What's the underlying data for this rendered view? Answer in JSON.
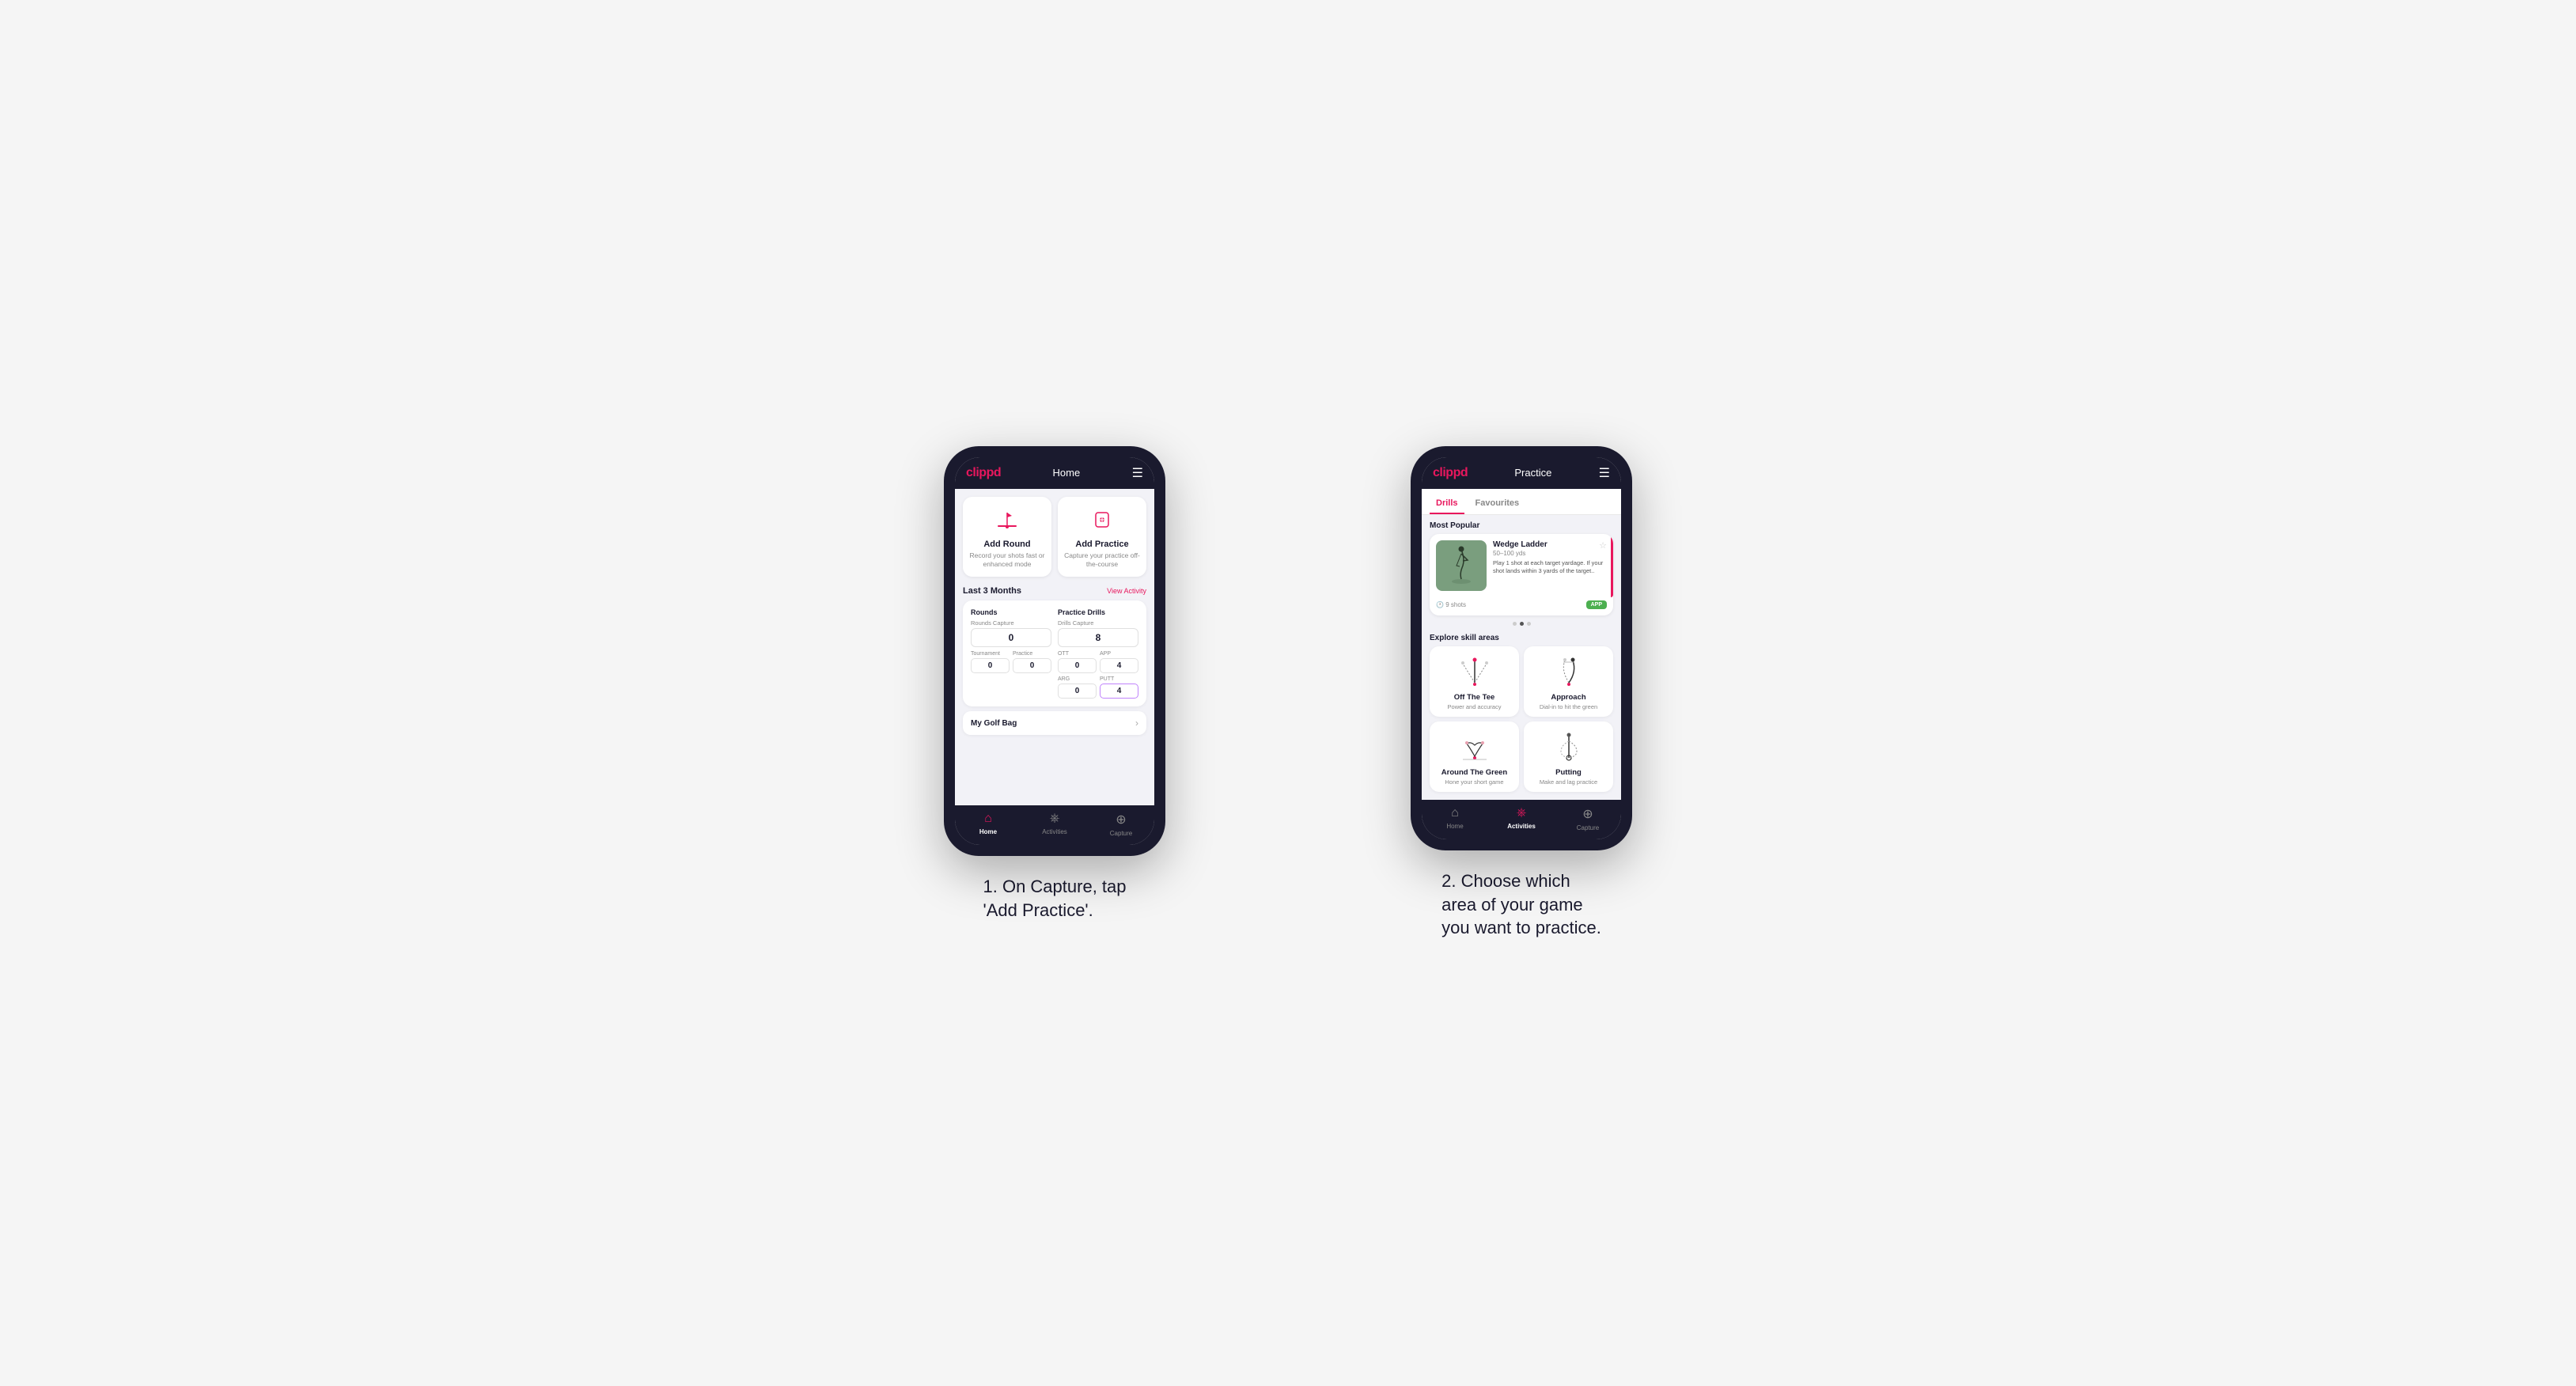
{
  "phone1": {
    "header": {
      "logo": "clippd",
      "title": "Home",
      "menu_icon": "☰"
    },
    "action_cards": [
      {
        "id": "add-round",
        "title": "Add Round",
        "subtitle": "Record your shots fast or enhanced mode"
      },
      {
        "id": "add-practice",
        "title": "Add Practice",
        "subtitle": "Capture your practice off-the-course"
      }
    ],
    "last_months_label": "Last 3 Months",
    "view_activity_label": "View Activity",
    "stats": {
      "rounds_title": "Rounds",
      "rounds_capture_label": "Rounds Capture",
      "rounds_value": "0",
      "tournament_label": "Tournament",
      "tournament_value": "0",
      "practice_label": "Practice",
      "practice_value": "0",
      "drills_title": "Practice Drills",
      "drills_capture_label": "Drills Capture",
      "drills_value": "8",
      "ott_label": "OTT",
      "ott_value": "0",
      "app_label": "APP",
      "app_value": "4",
      "arg_label": "ARG",
      "arg_value": "0",
      "putt_label": "PUTT",
      "putt_value": "4"
    },
    "golf_bag_label": "My Golf Bag",
    "nav": [
      {
        "label": "Home",
        "active": true
      },
      {
        "label": "Activities",
        "active": false
      },
      {
        "label": "Capture",
        "active": false
      }
    ]
  },
  "phone2": {
    "header": {
      "logo": "clippd",
      "title": "Practice",
      "menu_icon": "☰"
    },
    "tabs": [
      {
        "label": "Drills",
        "active": true
      },
      {
        "label": "Favourites",
        "active": false
      }
    ],
    "most_popular_label": "Most Popular",
    "featured": {
      "title": "Wedge Ladder",
      "yardage": "50–100 yds",
      "description": "Play 1 shot at each target yardage. If your shot lands within 3 yards of the target..",
      "shots": "9 shots",
      "tag": "APP"
    },
    "dots": [
      {
        "active": false
      },
      {
        "active": true
      },
      {
        "active": false
      }
    ],
    "explore_label": "Explore skill areas",
    "skills": [
      {
        "name": "Off The Tee",
        "desc": "Power and accuracy",
        "diagram": "ott"
      },
      {
        "name": "Approach",
        "desc": "Dial-in to hit the green",
        "diagram": "approach"
      },
      {
        "name": "Around The Green",
        "desc": "Hone your short game",
        "diagram": "atg"
      },
      {
        "name": "Putting",
        "desc": "Make and lag practice",
        "diagram": "putting"
      }
    ],
    "nav": [
      {
        "label": "Home",
        "active": false
      },
      {
        "label": "Activities",
        "active": true
      },
      {
        "label": "Capture",
        "active": false
      }
    ]
  },
  "caption1": "1. On Capture, tap\n'Add Practice'.",
  "caption2": "2. Choose which\narea of your game\nyou want to practice."
}
